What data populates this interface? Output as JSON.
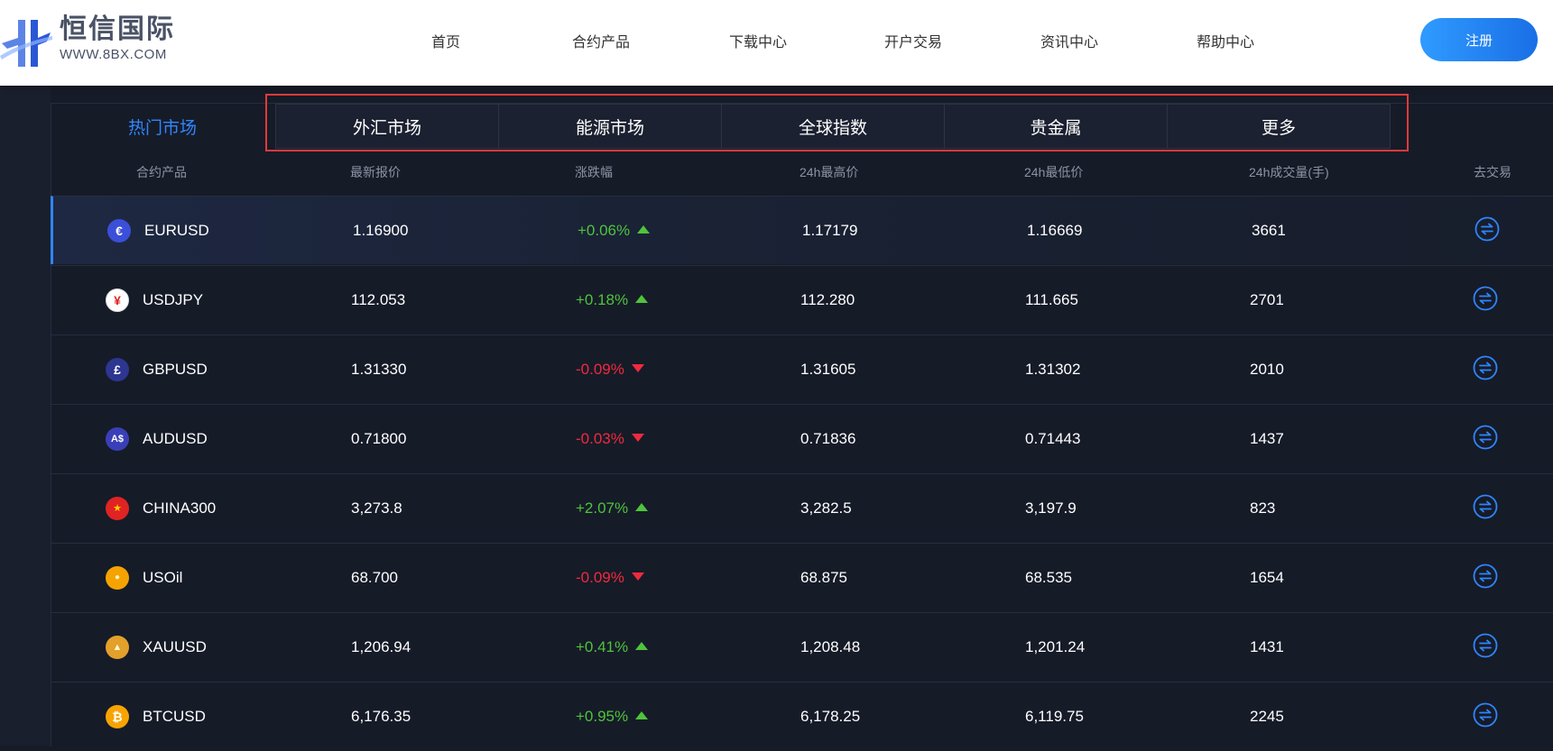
{
  "brand": {
    "name": "恒信国际",
    "url": "WWW.8BX.COM"
  },
  "nav": {
    "items": [
      "首页",
      "合约产品",
      "下载中心",
      "开户交易",
      "资讯中心",
      "帮助中心"
    ],
    "register": "注册"
  },
  "market_tabs": {
    "active": "热门市场",
    "items": [
      "外汇市场",
      "能源市场",
      "全球指数",
      "贵金属",
      "更多"
    ]
  },
  "table": {
    "headers": [
      "合约产品",
      "最新报价",
      "涨跌幅",
      "24h最高价",
      "24h最低价",
      "24h成交量(手)",
      "去交易"
    ],
    "rows": [
      {
        "icon": "euro-icon",
        "icon_glyph": "€",
        "icon_color": "#3b4fd8",
        "symbol": "EURUSD",
        "price": "1.16900",
        "change": "+0.06%",
        "dir": "up",
        "high": "1.17179",
        "low": "1.16669",
        "volume": "3661"
      },
      {
        "icon": "yen-icon",
        "icon_glyph": "¥",
        "icon_color": "#ffffff",
        "symbol": "USDJPY",
        "price": "112.053",
        "change": "+0.18%",
        "dir": "up",
        "high": "112.280",
        "low": "111.665",
        "volume": "2701"
      },
      {
        "icon": "pound-icon",
        "icon_glyph": "£",
        "icon_color": "#2d3690",
        "symbol": "GBPUSD",
        "price": "1.31330",
        "change": "-0.09%",
        "dir": "down",
        "high": "1.31605",
        "low": "1.31302",
        "volume": "2010"
      },
      {
        "icon": "aud-icon",
        "icon_glyph": "A$",
        "icon_color": "#3a3fb8",
        "symbol": "AUDUSD",
        "price": "0.71800",
        "change": "-0.03%",
        "dir": "down",
        "high": "0.71836",
        "low": "0.71443",
        "volume": "1437"
      },
      {
        "icon": "china-flag-icon",
        "icon_glyph": "★",
        "icon_color": "#e02323",
        "symbol": "CHINA300",
        "price": "3,273.8",
        "change": "+2.07%",
        "dir": "up",
        "high": "3,282.5",
        "low": "3,197.9",
        "volume": "823"
      },
      {
        "icon": "oil-drop-icon",
        "icon_glyph": "●",
        "icon_color": "#f5a300",
        "symbol": "USOil",
        "price": "68.700",
        "change": "-0.09%",
        "dir": "down",
        "high": "68.875",
        "low": "68.535",
        "volume": "1654"
      },
      {
        "icon": "gold-bars-icon",
        "icon_glyph": "▲",
        "icon_color": "#e3a02a",
        "symbol": "XAUUSD",
        "price": "1,206.94",
        "change": "+0.41%",
        "dir": "up",
        "high": "1,208.48",
        "low": "1,201.24",
        "volume": "1431"
      },
      {
        "icon": "bitcoin-icon",
        "icon_glyph": "₿",
        "icon_color": "#f7a400",
        "symbol": "BTCUSD",
        "price": "6,176.35",
        "change": "+0.95%",
        "dir": "up",
        "high": "6,178.25",
        "low": "6,119.75",
        "volume": "2245"
      }
    ]
  },
  "colors": {
    "accent": "#2f86ff",
    "up": "#4fc33c",
    "down": "#f02a3e",
    "background": "#161b28"
  }
}
